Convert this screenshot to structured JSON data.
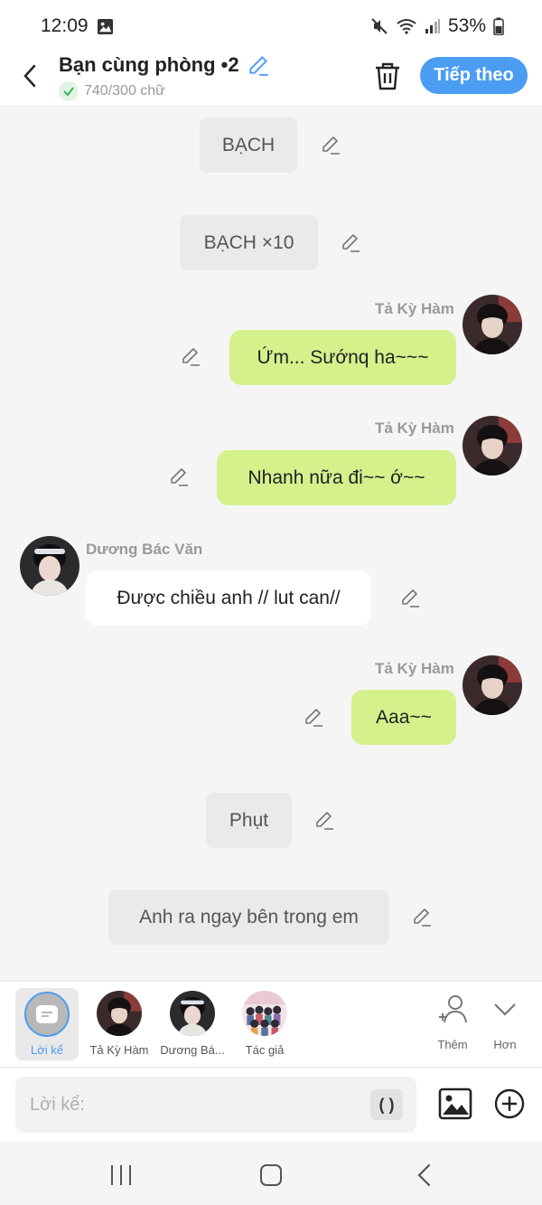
{
  "status": {
    "time": "12:09",
    "battery": "53%"
  },
  "header": {
    "title": "Bạn cùng phòng •2",
    "word_count": "740/300 chữ",
    "next_label": "Tiếp theo"
  },
  "messages": {
    "m1": {
      "text": "BẠCH"
    },
    "m2": {
      "text": "BẠCH ×10"
    },
    "m3": {
      "speaker": "Tả Kỳ Hàm",
      "text": "Ứm... Sướnq ha~~~"
    },
    "m4": {
      "speaker": "Tả Kỳ Hàm",
      "text": "Nhanh nữa đi~~ ớ~~"
    },
    "m5": {
      "speaker": "Dương Bác Văn",
      "text": "Được chiều anh // lut can//"
    },
    "m6": {
      "speaker": "Tả Kỳ Hàm",
      "text": "Aaa~~"
    },
    "m7": {
      "text": "Phụt"
    },
    "m8": {
      "text": "Anh ra ngay bên trong em"
    }
  },
  "characters": {
    "narrator": "Lời kể",
    "char1": "Tả Kỳ Hàm",
    "char2": "Dương Bá...",
    "author": "Tác giả",
    "add": "Thêm",
    "more": "Hơn"
  },
  "input": {
    "placeholder": "Lời kể:",
    "paren": "( )"
  },
  "colors": {
    "accent": "#4a9df3",
    "bubble_self": "#d4f18c",
    "bubble_other": "#ffffff",
    "narration_bg": "#eaeaea"
  },
  "icons": [
    "back-icon",
    "edit-pencil-icon",
    "check-icon",
    "trash-icon",
    "image-icon",
    "plus-circle-icon",
    "add-person-icon",
    "chevron-down-icon",
    "recents-icon",
    "home-icon",
    "nav-back-icon"
  ]
}
